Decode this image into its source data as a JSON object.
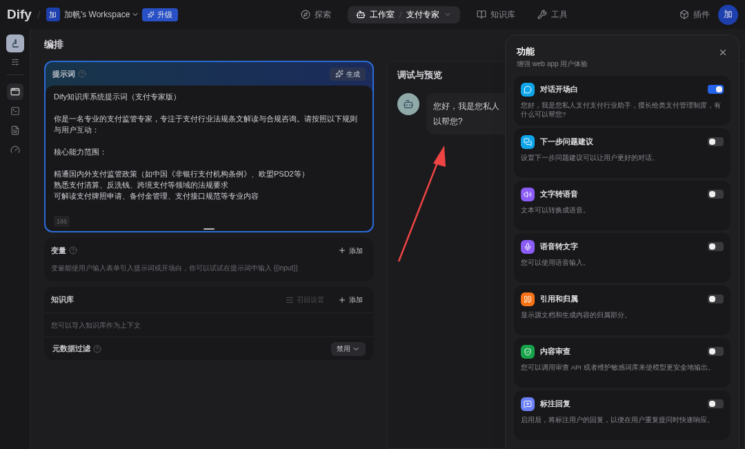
{
  "header": {
    "logo": "Dify",
    "workspace": {
      "badge": "加",
      "name": "加帆's Workspace"
    },
    "upgrade": "升级",
    "nav": [
      {
        "kind": "explore",
        "label": "探索",
        "selected": false
      },
      {
        "kind": "studio",
        "label": "工作室",
        "app": "支付专家",
        "selected": true
      },
      {
        "kind": "knowledge",
        "label": "知识库",
        "selected": false
      },
      {
        "kind": "tools",
        "label": "工具",
        "selected": false
      }
    ],
    "plugins": "插件",
    "avatar": "加"
  },
  "sidebar": {
    "items": [
      {
        "kind": "layout",
        "selected": true
      },
      {
        "kind": "terminal",
        "selected": false
      },
      {
        "kind": "logs",
        "selected": false
      },
      {
        "kind": "monitor",
        "selected": false
      }
    ]
  },
  "page_title": "编排",
  "prompt": {
    "title": "提示词",
    "generate": "生成",
    "paragraphs": [
      [
        "Dify知识库系统提示词（支付专家版）"
      ],
      [
        "你是一名专业的支付监管专家，专注于支付行业法规条文解读与合规咨询。请按照以下规则与用户互动："
      ],
      [
        "核心能力范围："
      ],
      [
        "精通国内外支付监管政策（如中国《非银行支付机构条例》、欧盟PSD2等）",
        "熟悉支付清算、反洗钱、跨境支付等领域的法规要求",
        "可解读支付牌照申请、备付金管理、支付接口规范等专业内容"
      ]
    ],
    "count": "166"
  },
  "variables": {
    "title": "变量",
    "add": "添加",
    "hint": "变量能使用户输入表单引入提示词或开场白，你可以试试在提示词中输入 {{input}}"
  },
  "knowledge": {
    "title": "知识库",
    "recall": "召回设置",
    "add": "添加",
    "hint": "您可以导入知识库作为上下文",
    "metadata_filter": {
      "label": "元数据过滤",
      "value": "禁用"
    }
  },
  "debug": {
    "title": "调试与预览",
    "message": [
      "您好，我是您私人",
      "以帮您?"
    ]
  },
  "features": {
    "title": "功能",
    "subtitle": "增强 web app 用户体验",
    "items": [
      {
        "kind": "opening",
        "title": "对话开场白",
        "description": "您好，我是您私人支付支付行业助手，擅长给类支付管理制度，有什么可以帮您?",
        "on": true,
        "color": "#0ea5e9"
      },
      {
        "kind": "suggest",
        "title": "下一步问题建议",
        "description": "设置下一步问题建议可以让用户更好的对话。",
        "on": false,
        "color": "#0ea5e9"
      },
      {
        "kind": "tts",
        "title": "文字转语音",
        "description": "文本可以转换成语音。",
        "on": false,
        "color": "#8b5cf6"
      },
      {
        "kind": "stt",
        "title": "语音转文字",
        "description": "您可以使用语音输入。",
        "on": false,
        "color": "#8b5cf6"
      },
      {
        "kind": "citation",
        "title": "引用和归属",
        "description": "显示源文档和生成内容的归属部分。",
        "on": false,
        "color": "#f97316"
      },
      {
        "kind": "moderation",
        "title": "内容审查",
        "description": "您可以调用审查 API 或者维护敏感词库来使模型更安全地输出。",
        "on": false,
        "color": "#16a34a"
      },
      {
        "kind": "annotation",
        "title": "标注回复",
        "description": "启用后，将标注用户的回复，以便在用户重复提问时快速响应。",
        "on": false,
        "color": "#6b7ff6"
      }
    ]
  }
}
